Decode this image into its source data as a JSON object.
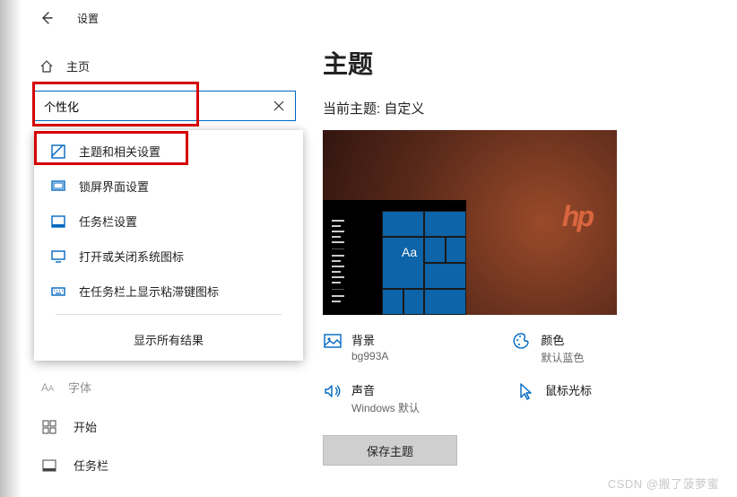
{
  "window": {
    "title": "设置"
  },
  "sidebar": {
    "home_label": "主页",
    "search_value": "个性化",
    "suggestions": [
      {
        "label": "主题和相关设置"
      },
      {
        "label": "锁屏界面设置"
      },
      {
        "label": "任务栏设置"
      },
      {
        "label": "打开或关闭系统图标"
      },
      {
        "label": "在任务栏上显示粘滞键图标"
      }
    ],
    "show_all_label": "显示所有结果",
    "faint_label": "字体",
    "nav": [
      {
        "label": "开始"
      },
      {
        "label": "任务栏"
      }
    ]
  },
  "main": {
    "heading": "主题",
    "subtitle": "当前主题: 自定义",
    "preview_tile_text": "Aa",
    "settings": {
      "background": {
        "label": "背景",
        "value": "bg993A"
      },
      "color": {
        "label": "颜色",
        "value": "默认蓝色"
      },
      "sound": {
        "label": "声音",
        "value": "Windows 默认"
      },
      "cursor": {
        "label": "鼠标光标",
        "value": ""
      }
    },
    "save_button": "保存主题"
  },
  "watermark": "CSDN @搬了菠萝蜜"
}
